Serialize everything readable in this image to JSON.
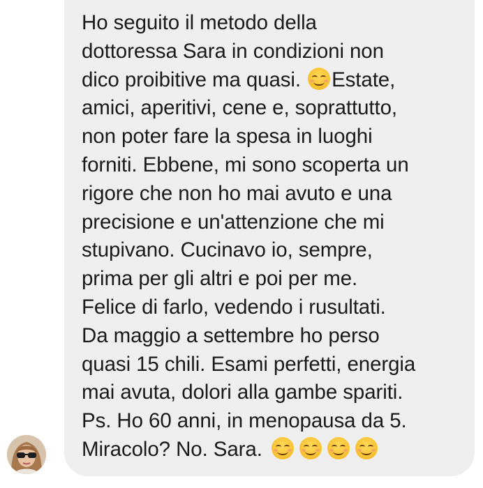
{
  "message": {
    "lines": [
      "Ho seguito il metodo della",
      "dottoressa Sara in condizioni non",
      "dico proibitive ma quasi.",
      "Estate,",
      "amici, aperitivi, cene e, soprattutto,",
      "non poter fare la spesa in luoghi",
      "forniti. Ebbene, mi sono scoperta un",
      "rigore che non ho mai avuto e una",
      "precisione e un'attenzione che mi",
      "stupivano. Cucinavo io, sempre,",
      "prima per gli altri e poi per me.",
      "Felice di farlo, vedendo i rusultati.",
      "Da maggio a settembre ho perso",
      "quasi 15 chili. Esami perfetti, energia",
      "mai avuta, dolori alla gambe spariti.",
      "Ps. Ho 60 anni, in menopausa da 5.",
      "Miracolo? No. Sara."
    ],
    "emoji_icon": "smiling-face-with-smiling-eyes"
  },
  "sender": {
    "avatar_icon": "profile-photo-woman-sunglasses"
  },
  "colors": {
    "bubble_background": "#efefef",
    "text": "#1a1a1a",
    "page_background": "#ffffff"
  }
}
